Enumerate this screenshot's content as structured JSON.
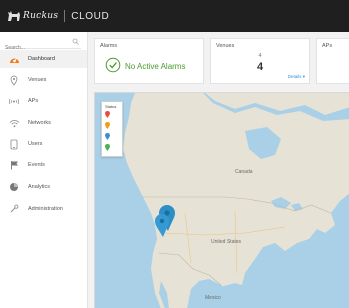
{
  "header": {
    "brand": "Ruckus",
    "product": "CLOUD",
    "colors": {
      "bar": "#1f1f1f",
      "logo": "#e0e0e0"
    }
  },
  "sidebar": {
    "search": {
      "placeholder": "Search..."
    },
    "items": [
      {
        "label": "Dashboard",
        "icon": "dashboard-icon",
        "active": true
      },
      {
        "label": "Venues",
        "icon": "location-pin-icon",
        "active": false
      },
      {
        "label": "APs",
        "icon": "access-point-icon",
        "active": false
      },
      {
        "label": "Networks",
        "icon": "wifi-icon",
        "active": false
      },
      {
        "label": "Users",
        "icon": "users-icon",
        "active": false
      },
      {
        "label": "Events",
        "icon": "flag-icon",
        "active": false
      },
      {
        "label": "Analytics",
        "icon": "pie-chart-icon",
        "active": false
      },
      {
        "label": "Administration",
        "icon": "wrench-icon",
        "active": false
      }
    ]
  },
  "cards": {
    "alarms": {
      "title": "Alarms",
      "status": "No Active Alarms",
      "color": "#4a9a2e"
    },
    "venues": {
      "title": "Venues",
      "count": "4",
      "link": "Details ▾"
    },
    "aps": {
      "title": "APs"
    }
  },
  "map": {
    "legend_title": "Status",
    "legend_colors": [
      "#e74c3c",
      "#f39c12",
      "#3a8fd2",
      "#4caf50"
    ],
    "labels": {
      "canada": "Canada",
      "us": "United States",
      "mexico": "Mexico"
    },
    "marker_color": "#2e8fc6",
    "colors": {
      "water": "#a9d0e6",
      "land": "#e6e2d6"
    }
  }
}
